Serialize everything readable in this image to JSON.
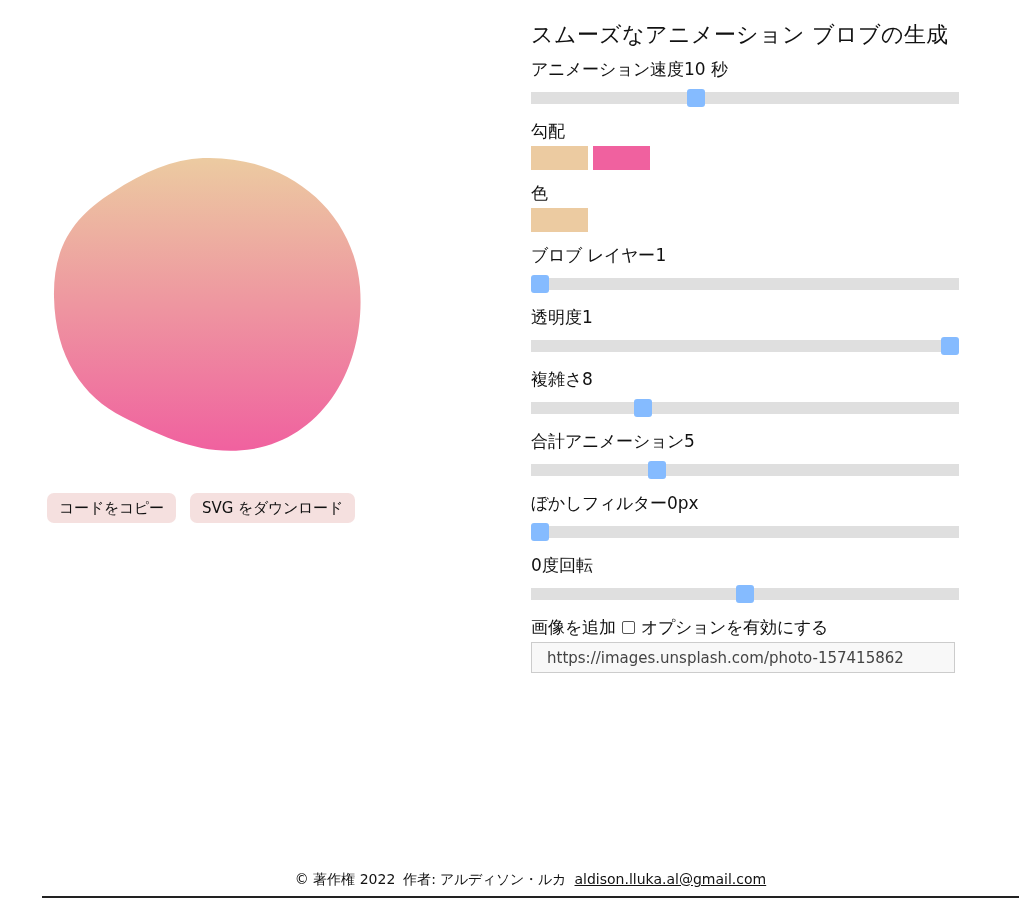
{
  "preview": {
    "buttons": [
      "コードをコピー",
      "SVG をダウンロード"
    ]
  },
  "settings": {
    "title": "スムーズなアニメーション ブロブの生成",
    "controls": [
      {
        "kind": "slider",
        "label": "アニメーション速度10 秒",
        "level": 0.38
      },
      {
        "kind": "swatches",
        "label": "勾配",
        "swatches": [
          {
            "color": "#eccba1"
          },
          {
            "color": "#f0619f"
          }
        ]
      },
      {
        "kind": "swatches",
        "label": "色",
        "swatches": [
          {
            "color": "#eccba1"
          }
        ]
      },
      {
        "kind": "slider",
        "label": "ブロブ レイヤー1",
        "level": 0
      },
      {
        "kind": "slider",
        "label": "透明度1",
        "level": 1
      },
      {
        "kind": "slider",
        "label": "複雑さ8",
        "level": 0.25
      },
      {
        "kind": "slider",
        "label": "合計アニメーション5",
        "level": 0.285
      },
      {
        "kind": "slider",
        "label": "ぼかしフィルター0px",
        "level": 0
      },
      {
        "kind": "slider",
        "label": "0度回転",
        "level": 0.5
      },
      {
        "kind": "image",
        "label": "画像を追加",
        "checked": false,
        "option": "オプションを有効にする",
        "value": "https://images.unsplash.com/photo-157415862"
      }
    ]
  },
  "footer": {
    "copyright": "© 著作権 2022",
    "author": "作者: アルディソン・ルカ",
    "email": "aldison.lluka.al@gmail.com"
  }
}
